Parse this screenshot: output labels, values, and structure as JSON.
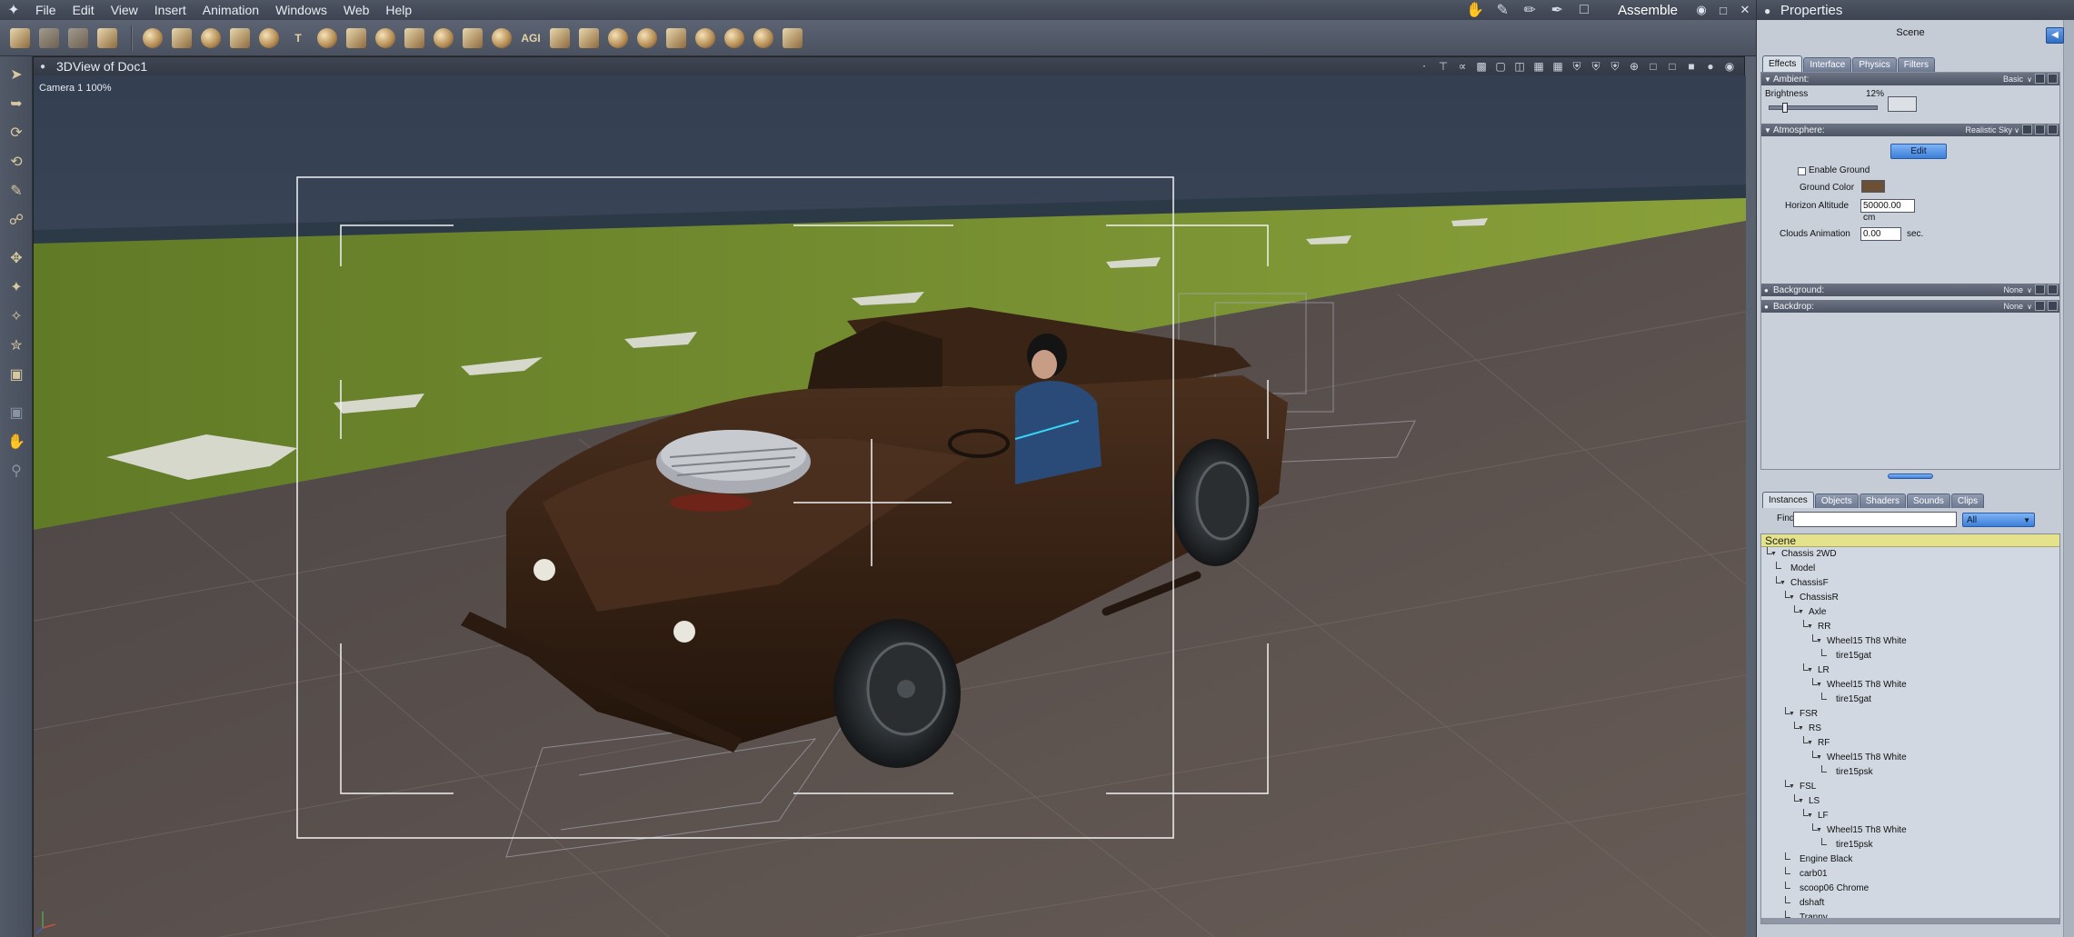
{
  "menubar": {
    "items": [
      "File",
      "Edit",
      "View",
      "Insert",
      "Animation",
      "Windows",
      "Web",
      "Help"
    ],
    "room": "Assemble"
  },
  "viewport": {
    "title": "3DView of Doc1",
    "camera_label": "Camera 1  100%"
  },
  "properties": {
    "title": "Properties",
    "context": "Scene",
    "effect_tabs": [
      "Effects",
      "Interface",
      "Physics",
      "Filters"
    ],
    "ambient": {
      "label": "Ambient:",
      "mode": "Basic",
      "brightness_label": "Brightness",
      "brightness_value": "12%",
      "brightness_fraction": 0.12,
      "color": "#dcdfe4"
    },
    "atmosphere": {
      "label": "Atmosphere:",
      "mode": "Realistic Sky",
      "edit_label": "Edit",
      "enable_ground_label": "Enable Ground",
      "ground_color_label": "Ground Color",
      "ground_color": "#6b5035",
      "horizon_label": "Horizon Altitude",
      "horizon_value": "50000.00 cm",
      "clouds_label": "Clouds Animation",
      "clouds_value": "0.00",
      "clouds_unit": "sec."
    },
    "background": {
      "label": "Background:",
      "value": "None"
    },
    "backdrop": {
      "label": "Backdrop:",
      "value": "None"
    },
    "instance_tabs": [
      "Instances",
      "Objects",
      "Shaders",
      "Sounds",
      "Clips"
    ],
    "find_label": "Find:",
    "find_value": "",
    "filter_value": "All",
    "tree_root": "Scene",
    "tree": [
      {
        "label": "Chassis 2WD",
        "depth": 0,
        "tri": true
      },
      {
        "label": "Model",
        "depth": 1,
        "tri": false
      },
      {
        "label": "ChassisF",
        "depth": 1,
        "tri": true
      },
      {
        "label": "ChassisR",
        "depth": 2,
        "tri": true
      },
      {
        "label": "Axle",
        "depth": 3,
        "tri": true
      },
      {
        "label": "RR",
        "depth": 4,
        "tri": true
      },
      {
        "label": "Wheel15 Th8 White",
        "depth": 5,
        "tri": true
      },
      {
        "label": "tire15gat",
        "depth": 6,
        "tri": false
      },
      {
        "label": "LR",
        "depth": 4,
        "tri": true
      },
      {
        "label": "Wheel15 Th8 White",
        "depth": 5,
        "tri": true
      },
      {
        "label": "tire15gat",
        "depth": 6,
        "tri": false
      },
      {
        "label": "FSR",
        "depth": 2,
        "tri": true
      },
      {
        "label": "RS",
        "depth": 3,
        "tri": true
      },
      {
        "label": "RF",
        "depth": 4,
        "tri": true
      },
      {
        "label": "Wheel15 Th8 White",
        "depth": 5,
        "tri": true
      },
      {
        "label": "tire15psk",
        "depth": 6,
        "tri": false
      },
      {
        "label": "FSL",
        "depth": 2,
        "tri": true
      },
      {
        "label": "LS",
        "depth": 3,
        "tri": true
      },
      {
        "label": "LF",
        "depth": 4,
        "tri": true
      },
      {
        "label": "Wheel15 Th8 White",
        "depth": 5,
        "tri": true
      },
      {
        "label": "tire15psk",
        "depth": 6,
        "tri": false
      },
      {
        "label": "Engine Black",
        "depth": 2,
        "tri": false
      },
      {
        "label": "carb01",
        "depth": 2,
        "tri": false
      },
      {
        "label": "scoop06 Chrome",
        "depth": 2,
        "tri": false
      },
      {
        "label": "dshaft",
        "depth": 2,
        "tri": false
      },
      {
        "label": "Tranny",
        "depth": 2,
        "tri": false
      }
    ]
  },
  "colors": {
    "ground": "#5c5452",
    "grass": "#6f8a2e",
    "car_body": "#3e2617",
    "sky": "#3b4454"
  }
}
